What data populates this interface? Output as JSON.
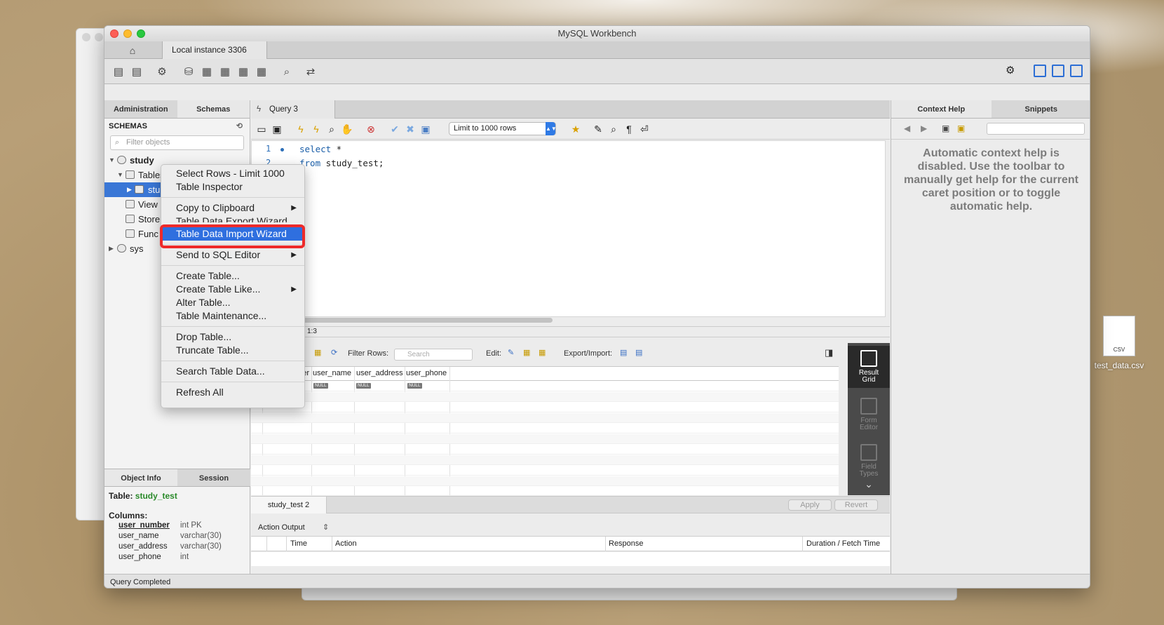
{
  "window": {
    "title": "MySQL Workbench"
  },
  "tabs": {
    "connection_tab": "Local instance 3306"
  },
  "left_panel": {
    "tabs": [
      "Administration",
      "Schemas"
    ],
    "schemas_header": "SCHEMAS",
    "filter_placeholder": "Filter objects",
    "tree": {
      "schema1": "study",
      "tables": "Tables",
      "table_partial": "stu",
      "views_partial": "View",
      "stored_partial": "Store",
      "func_partial": "Func",
      "schema2": "sys"
    },
    "bottom_tabs": [
      "Object Info",
      "Session"
    ],
    "object_info": {
      "table_label": "Table:",
      "table_name": "study_test",
      "columns_label": "Columns:",
      "columns": [
        {
          "name": "user_number",
          "type": "int PK"
        },
        {
          "name": "user_name",
          "type": "varchar(30)"
        },
        {
          "name": "user_address",
          "type": "varchar(30)"
        },
        {
          "name": "user_phone",
          "type": "int"
        }
      ]
    }
  },
  "query": {
    "tab_label": "Query 3",
    "limit_select": "Limit to 1000 rows",
    "lines": [
      "1",
      "2",
      "3"
    ],
    "code_line1_kw": "select",
    "code_line1_rest": " *",
    "code_line2_kw": "from",
    "code_line2_rest": " study_test;",
    "cursor_pos": "1:3"
  },
  "results": {
    "toolbar": {
      "grid_partial": "rid",
      "filter_label": "Filter Rows:",
      "search_placeholder": "Search",
      "edit_label": "Edit:",
      "export_label": "Export/Import:"
    },
    "columns": [
      "mber",
      "user_name",
      "user_address",
      "user_phone"
    ],
    "null_label": "NULL",
    "side": [
      {
        "label1": "Result",
        "label2": "Grid"
      },
      {
        "label1": "Form",
        "label2": "Editor"
      },
      {
        "label1": "Field",
        "label2": "Types"
      }
    ],
    "result_tab": "study_test 2",
    "apply": "Apply",
    "revert": "Revert"
  },
  "action_output": {
    "label": "Action Output",
    "columns": [
      "Time",
      "Action",
      "Response",
      "Duration / Fetch Time"
    ]
  },
  "right_panel": {
    "tabs": [
      "Context Help",
      "Snippets"
    ],
    "help_text": "Automatic context help is disabled. Use the toolbar to manually get help for the current caret position or to toggle automatic help."
  },
  "status": "Query Completed",
  "context_menu": {
    "items": [
      "Select Rows - Limit 1000",
      "Table Inspector",
      "Copy to Clipboard",
      "Table Data Export Wizard",
      "Table Data Import Wizard",
      "Send to SQL Editor",
      "Create Table...",
      "Create Table Like...",
      "Alter Table...",
      "Table Maintenance...",
      "Drop Table...",
      "Truncate Table...",
      "Search Table Data...",
      "Refresh All"
    ],
    "highlighted": "Table Data Import Wizard"
  },
  "desktop": {
    "file_name": "test_data.csv",
    "file_type": "CSV"
  },
  "colors": {
    "accent": "#2f6fdf",
    "highlight_box": "#ee2a2a",
    "table_name": "#2a8a2a"
  }
}
